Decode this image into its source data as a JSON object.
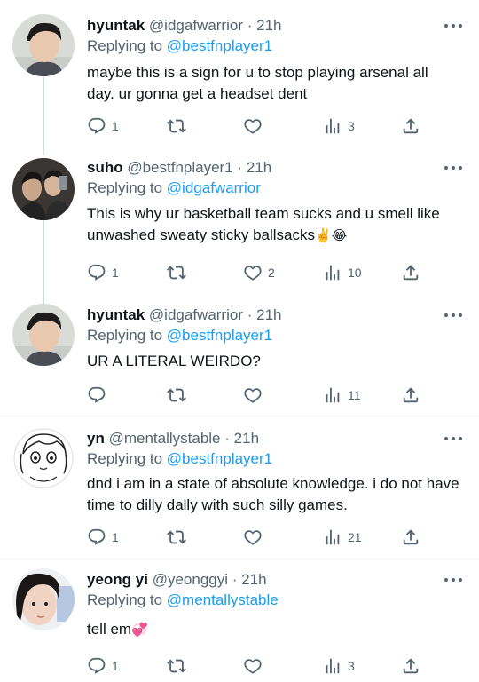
{
  "tweets": [
    {
      "name": "hyuntak",
      "handle": "@idgafwarrior",
      "sep": "·",
      "time": "21h",
      "replying_label": "Replying to",
      "replying_to": "@bestfnplayer1",
      "text": "maybe this is a sign for u to stop playing arsenal all day. ur gonna get a headset dent",
      "reply_count": "1",
      "retweet_count": "",
      "like_count": "",
      "view_count": "3"
    },
    {
      "name": "suho",
      "handle": "@bestfnplayer1",
      "sep": "·",
      "time": "21h",
      "replying_label": "Replying to",
      "replying_to": "@idgafwarrior",
      "text": "This is why ur basketball team sucks and u smell like unwashed sweaty sticky ballsacks",
      "text_emoji": "✌️😂",
      "reply_count": "1",
      "retweet_count": "",
      "like_count": "2",
      "view_count": "10"
    },
    {
      "name": "hyuntak",
      "handle": "@idgafwarrior",
      "sep": "·",
      "time": "21h",
      "replying_label": "Replying to",
      "replying_to": "@bestfnplayer1",
      "text": "UR A LITERAL WEIRDO?",
      "reply_count": "",
      "retweet_count": "",
      "like_count": "",
      "view_count": "11"
    },
    {
      "name": "yn",
      "handle": "@mentallystable",
      "sep": "·",
      "time": "21h",
      "replying_label": "Replying to",
      "replying_to": "@bestfnplayer1",
      "text": "dnd i am in a state of absolute knowledge. i do not have time to dilly dally with such silly games.",
      "reply_count": "1",
      "retweet_count": "",
      "like_count": "",
      "view_count": "21"
    },
    {
      "name": "yeong yi",
      "handle": "@yeonggyi",
      "sep": "·",
      "time": "21h",
      "replying_label": "Replying to",
      "replying_to": "@mentallystable",
      "text": "tell em",
      "text_emoji": "💞",
      "reply_count": "1",
      "retweet_count": "",
      "like_count": "",
      "view_count": "3"
    }
  ],
  "icons": {
    "reply": "reply-icon",
    "retweet": "retweet-icon",
    "like": "heart-icon",
    "views": "views-icon",
    "share": "share-icon",
    "more": "more-options-icon"
  },
  "colors": {
    "text": "#0f1419",
    "secondary": "#536471",
    "link": "#1d9bf0",
    "thread_line": "#cfd9de"
  }
}
